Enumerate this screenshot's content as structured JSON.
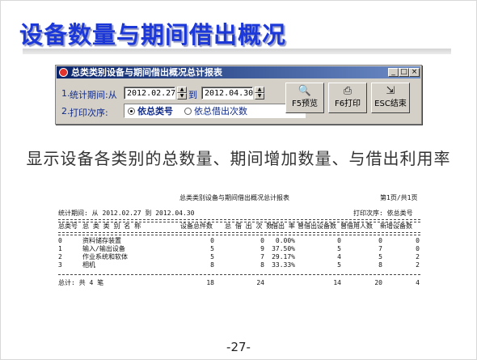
{
  "slide": {
    "title": "设备数量与期间借出概况",
    "subtitle": "显示设备各类别的总数量、期间增加数量、与借出利用率",
    "page_number": "-27-"
  },
  "window": {
    "title": "总类类别设备与期间借出概况总计报表",
    "controls": [
      "_",
      "□",
      "×"
    ],
    "period_label_num": "1.",
    "period_label": "统计期间:从",
    "start_date": "2012.02.27",
    "to_label": "到",
    "end_date": "2012.04.30",
    "order_label_num": "2.",
    "order_label": "打印次序:",
    "order_options": [
      "依总类号",
      "依总借出次数"
    ],
    "order_selected": "依总类号",
    "buttons": [
      {
        "label": "F5预览",
        "icon": "preview-icon"
      },
      {
        "label": "F6打印",
        "icon": "printer-icon"
      },
      {
        "label": "ESC结束",
        "icon": "exit-icon"
      }
    ]
  },
  "report": {
    "title": "总类类别设备与期间借出概况总计报表",
    "page_info": "第1页/共1页",
    "period": "统计期间: 从 2012.02.27 到 2012.04.30",
    "order": "打印次序: 依总类号",
    "columns": [
      "总类号",
      "总 类 类 别 名 称",
      "设备总件数",
      "总 借 出 次 数",
      "借出 率",
      "曾借出设备数",
      "曾借用人数",
      "新增设备数"
    ],
    "rows": [
      [
        "0",
        "资料储存装置",
        "0",
        "0",
        "0.00%",
        "0",
        "0",
        "0"
      ],
      [
        "1",
        "输入/输出设备",
        "5",
        "9",
        "37.50%",
        "5",
        "7",
        "0"
      ],
      [
        "2",
        "作业系统和软体",
        "5",
        "7",
        "29.17%",
        "4",
        "5",
        "2"
      ],
      [
        "3",
        "相机",
        "8",
        "8",
        "33.33%",
        "5",
        "8",
        "2"
      ]
    ],
    "total_label": "总计: 共 4 笔",
    "totals": [
      "18",
      "24",
      "14",
      "20",
      "4"
    ]
  }
}
